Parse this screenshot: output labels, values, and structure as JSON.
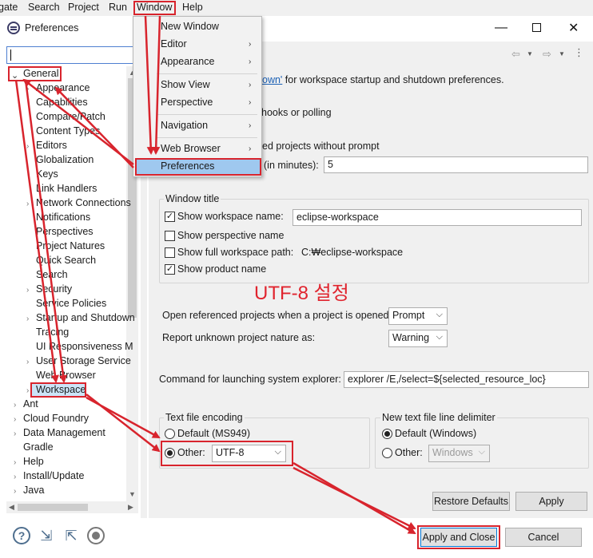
{
  "menubar": [
    "gate",
    "Search",
    "Project",
    "Run",
    "Window",
    "Help"
  ],
  "dialog": {
    "title": "Preferences",
    "window_controls": [
      "minimize",
      "maximize",
      "close"
    ]
  },
  "tree": {
    "filter_value": "",
    "general": "General",
    "general_children": [
      "Appearance",
      "Capabilities",
      "Compare/Patch",
      "Content Types",
      "Editors",
      "Globalization",
      "Keys",
      "Link Handlers",
      "Network Connections",
      "Notifications",
      "Perspectives",
      "Project Natures",
      "Quick Search",
      "Search",
      "Security",
      "Service Policies",
      "Startup and Shutdown",
      "Tracing",
      "UI Responsiveness M",
      "User Storage Service",
      "Web Browser",
      "Workspace"
    ],
    "top_level": [
      "Ant",
      "Cloud Foundry",
      "Data Management",
      "Gradle",
      "Help",
      "Install/Update",
      "Java"
    ]
  },
  "window_menu": {
    "items": [
      "New Window",
      "Editor",
      "Appearance",
      "Show View",
      "Perspective",
      "Navigation",
      "Web Browser",
      "Preferences"
    ],
    "selected": "Preferences"
  },
  "workspace": {
    "startup_link": "own'",
    "startup_rest": " for workspace startup and shutdown preferences.",
    "refresh_fragment": "hooks or polling",
    "save_fragment": "ed projects without prompt",
    "interval_label": "(in minutes):",
    "interval_value": "5",
    "window_title_group": "Window title",
    "show_workspace_name_label": "Show workspace name:",
    "show_workspace_name_checked": true,
    "workspace_name_value": "eclipse-workspace",
    "show_perspective_name_label": "Show perspective name",
    "show_perspective_name_checked": false,
    "show_full_path_label": "Show full workspace path:",
    "show_full_path_checked": false,
    "full_path_value": "C:₩eclipse-workspace",
    "show_product_name_label": "Show product name",
    "show_product_name_checked": true,
    "annotation": "UTF-8 설정",
    "open_ref_label": "Open referenced projects when a project is opened:",
    "open_ref_value": "Prompt",
    "unknown_nature_label": "Report unknown project nature as:",
    "unknown_nature_value": "Warning",
    "explorer_label": "Command for launching system explorer:",
    "explorer_value": "explorer /E,/select=${selected_resource_loc}",
    "encoding_group": "Text file encoding",
    "encoding_default_label": "Default (MS949)",
    "encoding_other_label": "Other:",
    "encoding_other_value": "UTF-8",
    "delimiter_group": "New text file line delimiter",
    "delimiter_default_label": "Default (Windows)",
    "delimiter_other_label": "Other:",
    "delimiter_other_value": "Windows",
    "restore_defaults": "Restore Defaults",
    "apply": "Apply"
  },
  "footer": {
    "apply_close": "Apply and Close",
    "cancel": "Cancel",
    "icons": [
      "help-icon",
      "import-icon",
      "export-icon",
      "record-icon"
    ]
  },
  "colors": {
    "annotation_red": "#d8242d",
    "selection_blue": "#9fc8ef"
  }
}
